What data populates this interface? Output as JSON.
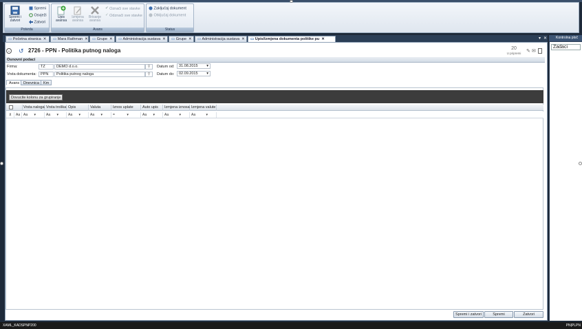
{
  "ribbon": {
    "groups": {
      "potvrda": {
        "title": "Potvrda"
      },
      "avans": {
        "title": "Avans"
      },
      "status": {
        "title": "Status"
      }
    },
    "save_close_label": "Spremi i zatvori",
    "save_label": "Spremi",
    "refresh_label": "Osvježi",
    "close_label": "Zatvori",
    "add_advance_label": "Upis avansa",
    "edit_advance_label": "Izmjena avansa",
    "delete_advance_label": "Brisanje avansa",
    "mark_all_label": "Označi sve stavke",
    "unmark_all_label": "Odznači sve stavke",
    "lock_doc_label": "Zaključaj dokument",
    "unlock_doc_label": "Otključaj dokument"
  },
  "tabs": [
    {
      "label": "Početna stranica"
    },
    {
      "label": "Mara Rathman"
    },
    {
      "label": "Grupe"
    },
    {
      "label": "Administracija sustava"
    },
    {
      "label": "Grupe"
    },
    {
      "label": "Administracija sustava"
    },
    {
      "label": "Upis/Izmjena dokumenta politike pu"
    }
  ],
  "doc": {
    "number": "2726",
    "type_code": "PPN",
    "title": "Politika putnog naloga",
    "status_count": "20",
    "status_label": "U pripremi",
    "section_title": "Osnovni podaci",
    "firm_label": "Firma:",
    "firm_code": "TZ",
    "firm_name": "DEMO d.o.o.",
    "doctype_label": "Vrsta dokumenta:",
    "doctype_code": "PPN",
    "doctype_name": "Politika putnog naloga",
    "date_from_label": "Datum od:",
    "date_from": "31.08.2015",
    "date_to_label": "Datum do:",
    "date_to": "02.09.2015"
  },
  "subtabs": [
    {
      "label": "Avans"
    },
    {
      "label": "Dnevnica"
    },
    {
      "label": "Km"
    }
  ],
  "grid": {
    "group_hint": "Dovucite kolonu za grupiranje",
    "columns": [
      "Vrsta naloga",
      "Vrsta troška",
      "Opis",
      "Valuta",
      "Iznos uplate",
      "Auto upis",
      "Izmjena iznosa",
      "Izmjena valute"
    ],
    "filter_ops": [
      "Aa",
      "Aa",
      "Aa",
      "Aa",
      "=",
      "Aa",
      "Aa",
      "Aa"
    ]
  },
  "footer": {
    "save_close": "Spremi i zatvori",
    "save": "Spremi",
    "close": "Zatvori"
  },
  "right_panel": {
    "title": "Kontrolna ploč",
    "tasks": "Zadaci"
  },
  "status_bar": {
    "left": "XAML_KADSPNP200",
    "right": "PN|PLPN"
  }
}
